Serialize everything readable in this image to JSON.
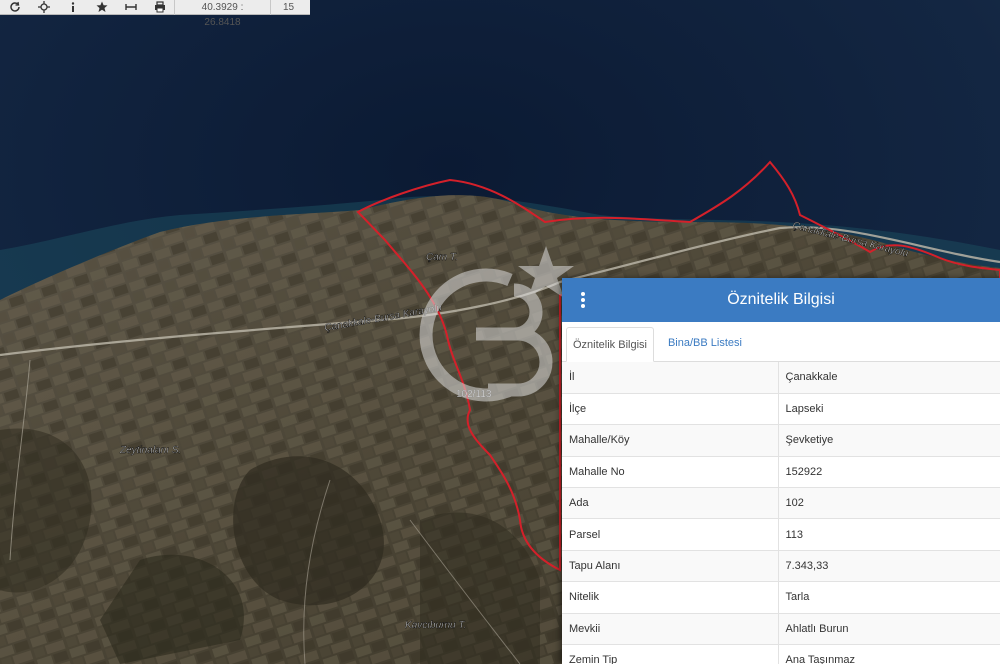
{
  "toolbar": {
    "buttons": [
      {
        "name": "refresh-icon",
        "glyph": "↻"
      },
      {
        "name": "move-icon",
        "glyph": "✥"
      },
      {
        "name": "info-icon",
        "glyph": "i"
      },
      {
        "name": "star-icon",
        "glyph": "★"
      },
      {
        "name": "measure-icon",
        "glyph": "↔"
      },
      {
        "name": "print-icon",
        "glyph": "⎙"
      }
    ],
    "coordinates": "40.3929 : 26.8418",
    "zoom": "15"
  },
  "map": {
    "labels": {
      "road_top": "Çanakkale-Bursa Karayolu",
      "road_center": "Çanakkale-Bursa Karayolu",
      "cam": "Çam T.",
      "zeytinalani": "Zeytinalanı S.",
      "kavciburnu": "Kavcıburnu T.",
      "parcel": "102/113"
    },
    "colors": {
      "parcel_border": "#d4202a",
      "sea": "#0f1d33",
      "land": "#4b4536"
    }
  },
  "panel": {
    "title": "Öznitelik Bilgisi",
    "tabs": [
      {
        "label": "Öznitelik Bilgisi",
        "active": true
      },
      {
        "label": "Bina/BB Listesi",
        "active": false
      }
    ],
    "rows": [
      {
        "key": "İl",
        "value": "Çanakkale"
      },
      {
        "key": "İlçe",
        "value": "Lapseki"
      },
      {
        "key": "Mahalle/Köy",
        "value": "Şevketiye"
      },
      {
        "key": "Mahalle No",
        "value": "152922"
      },
      {
        "key": "Ada",
        "value": "102"
      },
      {
        "key": "Parsel",
        "value": "113"
      },
      {
        "key": "Tapu Alanı",
        "value": "7.343,33"
      },
      {
        "key": "Nitelik",
        "value": "Tarla"
      },
      {
        "key": "Mevkii",
        "value": "Ahlatlı Burun"
      },
      {
        "key": "Zemin Tip",
        "value": "Ana Taşınmaz"
      }
    ],
    "colors": {
      "header": "#3b7bc2",
      "link": "#3b7bc2"
    }
  }
}
